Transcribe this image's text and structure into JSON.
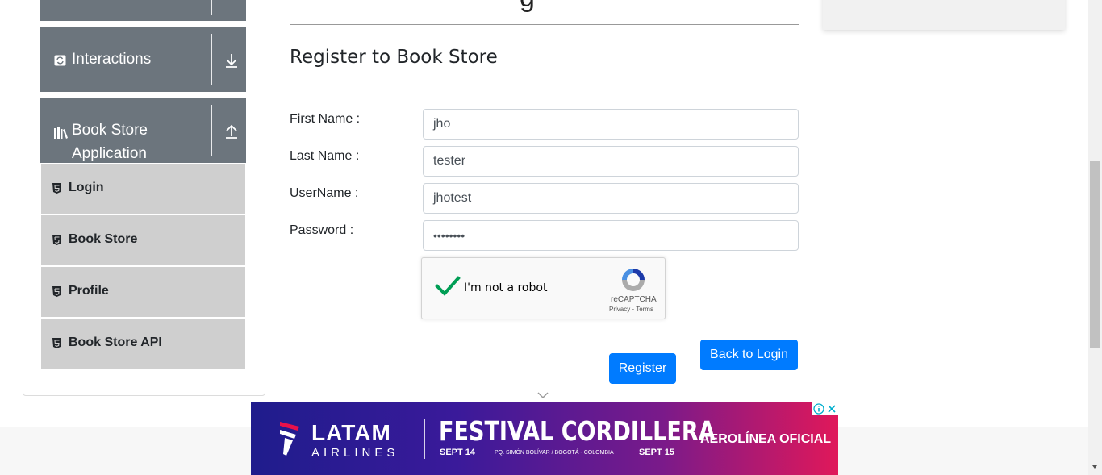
{
  "sidebar": {
    "groups": [
      {
        "title": "Interactions",
        "icon": "repeat-icon",
        "state_icon": "arrow-down-icon"
      },
      {
        "title_line1": "Book Store",
        "title_line2": "Application",
        "icon": "books-icon",
        "state_icon": "arrow-up-icon"
      }
    ],
    "items": [
      {
        "label": "Login",
        "icon": "html5-icon"
      },
      {
        "label": "Book Store",
        "icon": "html5-icon"
      },
      {
        "label": "Profile",
        "icon": "html5-icon"
      },
      {
        "label": "Book Store API",
        "icon": "html5-icon"
      }
    ]
  },
  "main": {
    "heading_remnant": "g",
    "form_title": "Register to Book Store",
    "fields": [
      {
        "label": "First Name :",
        "value": "jho"
      },
      {
        "label": "Last Name :",
        "value": "tester"
      },
      {
        "label": "UserName :",
        "value": "jhotest"
      },
      {
        "label": "Password :",
        "value": "••••••••"
      }
    ],
    "recaptcha": {
      "label": "I'm not a robot",
      "brand": "reCAPTCHA",
      "links": "Privacy - Terms",
      "checked": true
    },
    "buttons": {
      "register": "Register",
      "back_to_login": "Back to Login"
    }
  },
  "ad": {
    "brand": "LATAM",
    "brand_sub": "AIRLINES",
    "headline": "FESTIVAL CORDILLERA",
    "date_start": "SEPT 14",
    "venue": "PQ. SIMÓN BOLÍVAR / BOGOTÁ - COLOMBIA",
    "date_end": "SEPT 15",
    "tagline": "AEROLÍNEA OFICIAL"
  },
  "colors": {
    "primary": "#007bff",
    "sidebar_group": "#6c757d",
    "sidebar_item": "#cfcfcf",
    "check_green": "#009e55"
  }
}
